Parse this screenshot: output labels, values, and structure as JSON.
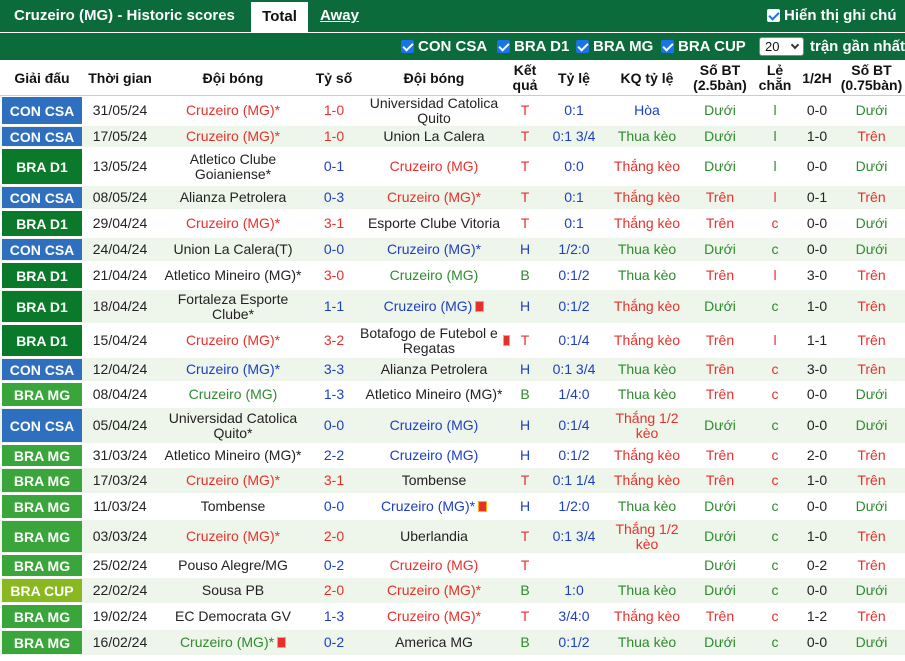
{
  "header": {
    "title": "Cruzeiro (MG) - Historic scores",
    "tab_total": "Total",
    "tab_away": "Away",
    "show_label": "Hiển thị ghi chú"
  },
  "filters": {
    "items": [
      "CON CSA",
      "BRA D1",
      "BRA MG",
      "BRA CUP"
    ],
    "count": "20",
    "recent_label": "trận gần nhất"
  },
  "columns": {
    "league": "Giải đấu",
    "date": "Thời gian",
    "home": "Đội bóng",
    "score": "Tỷ số",
    "away": "Đội bóng",
    "result": "Kết quả",
    "odds": "Tỷ lệ",
    "odds_result": "KQ tỷ lệ",
    "goals": "Số BT (2.5bàn)",
    "oddeven": "Lẻ chẵn",
    "half": "1/2H",
    "goals75": "Số BT (0.75bàn)"
  },
  "colors": {
    "CON CSA": "#2f6fc0",
    "BRA D1": "#0a7a2a",
    "BRA MG": "#3aa53a",
    "BRA CUP": "#8ab820",
    "header_green": "#0b6b3a"
  },
  "rows": [
    {
      "league": "CON CSA",
      "date": "31/05/24",
      "home": "Cruzeiro (MG)*",
      "score": "1-0",
      "away": "Universidad Catolica Quito",
      "result": "T",
      "odds": "0:1",
      "odds_result": "Hòa",
      "goals": "Dưới",
      "oe": "l",
      "half": "0-0",
      "goals75": "Dưới",
      "hc": "red",
      "ac": "dark",
      "ss": "red",
      "rc": "red",
      "okc": "blue",
      "gc": "green",
      "g75c": "green"
    },
    {
      "league": "CON CSA",
      "date": "17/05/24",
      "home": "Cruzeiro (MG)*",
      "score": "1-0",
      "away": "Union La Calera",
      "result": "T",
      "odds": "0:1 3/4",
      "odds_result": "Thua kèo",
      "goals": "Dưới",
      "oe": "l",
      "half": "1-0",
      "goals75": "Trên",
      "hc": "red",
      "ac": "dark",
      "ss": "red",
      "rc": "red",
      "okc": "green",
      "gc": "green",
      "g75c": "red"
    },
    {
      "league": "BRA D1",
      "date": "13/05/24",
      "home": "Atletico Clube Goianiense*",
      "score": "0-1",
      "away": "Cruzeiro (MG)",
      "result": "T",
      "odds": "0:0",
      "odds_result": "Thắng kèo",
      "goals": "Dưới",
      "oe": "l",
      "half": "0-0",
      "goals75": "Dưới",
      "hc": "dark",
      "ac": "red",
      "ss": "blue",
      "rc": "red",
      "okc": "red",
      "gc": "green",
      "g75c": "green"
    },
    {
      "league": "CON CSA",
      "date": "08/05/24",
      "home": "Alianza Petrolera",
      "score": "0-3",
      "away": "Cruzeiro (MG)*",
      "result": "T",
      "odds": "0:1",
      "odds_result": "Thắng kèo",
      "goals": "Trên",
      "oe": "l",
      "half": "0-1",
      "goals75": "Trên",
      "hc": "dark",
      "ac": "red",
      "ss": "blue",
      "rc": "red",
      "okc": "red",
      "gc": "red",
      "g75c": "red"
    },
    {
      "league": "BRA D1",
      "date": "29/04/24",
      "home": "Cruzeiro (MG)*",
      "score": "3-1",
      "away": "Esporte Clube Vitoria",
      "result": "T",
      "odds": "0:1",
      "odds_result": "Thắng kèo",
      "goals": "Trên",
      "oe": "c",
      "half": "0-0",
      "goals75": "Dưới",
      "hc": "red",
      "ac": "dark",
      "ss": "red",
      "rc": "red",
      "okc": "red",
      "gc": "red",
      "g75c": "green"
    },
    {
      "league": "CON CSA",
      "date": "24/04/24",
      "home": "Union La Calera(T)",
      "score": "0-0",
      "away": "Cruzeiro (MG)*",
      "result": "H",
      "odds": "1/2:0",
      "odds_result": "Thua kèo",
      "goals": "Dưới",
      "oe": "c",
      "half": "0-0",
      "goals75": "Dưới",
      "hc": "dark",
      "ac": "blue",
      "ss": "blue",
      "rc": "blue",
      "okc": "green",
      "gc": "green",
      "g75c": "green"
    },
    {
      "league": "BRA D1",
      "date": "21/04/24",
      "home": "Atletico Mineiro (MG)*",
      "score": "3-0",
      "away": "Cruzeiro (MG)",
      "result": "B",
      "odds": "0:1/2",
      "odds_result": "Thua kèo",
      "goals": "Trên",
      "oe": "l",
      "half": "3-0",
      "goals75": "Trên",
      "hc": "dark",
      "ac": "green",
      "ss": "red",
      "rc": "green",
      "okc": "green",
      "gc": "red",
      "g75c": "red"
    },
    {
      "league": "BRA D1",
      "date": "18/04/24",
      "home": "Fortaleza Esporte Clube*",
      "score": "1-1",
      "away": "Cruzeiro (MG)",
      "result": "H",
      "odds": "0:1/2",
      "odds_result": "Thắng kèo",
      "goals": "Dưới",
      "oe": "c",
      "half": "1-0",
      "goals75": "Trên",
      "hc": "dark",
      "ac": "blue",
      "ss": "blue",
      "rc": "blue",
      "okc": "red",
      "gc": "green",
      "g75c": "red",
      "flag": "away"
    },
    {
      "league": "BRA D1",
      "date": "15/04/24",
      "home": "Cruzeiro (MG)*",
      "score": "3-2",
      "away": "Botafogo de Futebol e Regatas",
      "result": "T",
      "odds": "0:1/4",
      "odds_result": "Thắng kèo",
      "goals": "Trên",
      "oe": "l",
      "half": "1-1",
      "goals75": "Trên",
      "hc": "red",
      "ac": "dark",
      "ss": "red",
      "rc": "red",
      "okc": "red",
      "gc": "red",
      "g75c": "red",
      "flag": "away"
    },
    {
      "league": "CON CSA",
      "date": "12/04/24",
      "home": "Cruzeiro (MG)*",
      "score": "3-3",
      "away": "Alianza Petrolera",
      "result": "H",
      "odds": "0:1 3/4",
      "odds_result": "Thua kèo",
      "goals": "Trên",
      "oe": "c",
      "half": "3-0",
      "goals75": "Trên",
      "hc": "blue",
      "ac": "dark",
      "ss": "blue",
      "rc": "blue",
      "okc": "green",
      "gc": "red",
      "g75c": "red"
    },
    {
      "league": "BRA MG",
      "date": "08/04/24",
      "home": "Cruzeiro (MG)",
      "score": "1-3",
      "away": "Atletico Mineiro (MG)*",
      "result": "B",
      "odds": "1/4:0",
      "odds_result": "Thua kèo",
      "goals": "Trên",
      "oe": "c",
      "half": "0-0",
      "goals75": "Dưới",
      "hc": "green",
      "ac": "dark",
      "ss": "blue",
      "rc": "green",
      "okc": "green",
      "gc": "red",
      "g75c": "green"
    },
    {
      "league": "CON CSA",
      "date": "05/04/24",
      "home": "Universidad Catolica Quito*",
      "score": "0-0",
      "away": "Cruzeiro (MG)",
      "result": "H",
      "odds": "0:1/4",
      "odds_result": "Thắng 1/2 kèo",
      "goals": "Dưới",
      "oe": "c",
      "half": "0-0",
      "goals75": "Dưới",
      "hc": "dark",
      "ac": "blue",
      "ss": "blue",
      "rc": "blue",
      "okc": "red",
      "gc": "green",
      "g75c": "green"
    },
    {
      "league": "BRA MG",
      "date": "31/03/24",
      "home": "Atletico Mineiro (MG)*",
      "score": "2-2",
      "away": "Cruzeiro (MG)",
      "result": "H",
      "odds": "0:1/2",
      "odds_result": "Thắng kèo",
      "goals": "Trên",
      "oe": "c",
      "half": "2-0",
      "goals75": "Trên",
      "hc": "dark",
      "ac": "blue",
      "ss": "blue",
      "rc": "blue",
      "okc": "red",
      "gc": "red",
      "g75c": "red"
    },
    {
      "league": "BRA MG",
      "date": "17/03/24",
      "home": "Cruzeiro (MG)*",
      "score": "3-1",
      "away": "Tombense",
      "result": "T",
      "odds": "0:1 1/4",
      "odds_result": "Thắng kèo",
      "goals": "Trên",
      "oe": "c",
      "half": "1-0",
      "goals75": "Trên",
      "hc": "red",
      "ac": "dark",
      "ss": "red",
      "rc": "red",
      "okc": "red",
      "gc": "red",
      "g75c": "red"
    },
    {
      "league": "BRA MG",
      "date": "11/03/24",
      "home": "Tombense",
      "score": "0-0",
      "away": "Cruzeiro (MG)*",
      "result": "H",
      "odds": "1/2:0",
      "odds_result": "Thua kèo",
      "goals": "Dưới",
      "oe": "c",
      "half": "0-0",
      "goals75": "Dưới",
      "hc": "dark",
      "ac": "blue",
      "ss": "blue",
      "rc": "blue",
      "okc": "green",
      "gc": "green",
      "g75c": "green",
      "flag": "away"
    },
    {
      "league": "BRA MG",
      "date": "03/03/24",
      "home": "Cruzeiro (MG)*",
      "score": "2-0",
      "away": "Uberlandia",
      "result": "T",
      "odds": "0:1 3/4",
      "odds_result": "Thắng 1/2 kèo",
      "goals": "Dưới",
      "oe": "c",
      "half": "1-0",
      "goals75": "Trên",
      "hc": "red",
      "ac": "dark",
      "ss": "red",
      "rc": "red",
      "okc": "red",
      "gc": "green",
      "g75c": "red"
    },
    {
      "league": "BRA MG",
      "date": "25/02/24",
      "home": "Pouso Alegre/MG",
      "score": "0-2",
      "away": "Cruzeiro (MG)",
      "result": "T",
      "odds": "",
      "odds_result": "",
      "goals": "Dưới",
      "oe": "c",
      "half": "0-2",
      "goals75": "Trên",
      "hc": "dark",
      "ac": "red",
      "ss": "blue",
      "rc": "red",
      "okc": "red",
      "gc": "green",
      "g75c": "red"
    },
    {
      "league": "BRA CUP",
      "date": "22/02/24",
      "home": "Sousa PB",
      "score": "2-0",
      "away": "Cruzeiro (MG)*",
      "result": "B",
      "odds": "1:0",
      "odds_result": "Thua kèo",
      "goals": "Dưới",
      "oe": "c",
      "half": "0-0",
      "goals75": "Dưới",
      "hc": "dark",
      "ac": "red",
      "ss": "red",
      "rc": "green",
      "okc": "green",
      "gc": "green",
      "g75c": "green"
    },
    {
      "league": "BRA MG",
      "date": "19/02/24",
      "home": "EC Democrata GV",
      "score": "1-3",
      "away": "Cruzeiro (MG)*",
      "result": "T",
      "odds": "3/4:0",
      "odds_result": "Thắng kèo",
      "goals": "Trên",
      "oe": "c",
      "half": "1-2",
      "goals75": "Trên",
      "hc": "dark",
      "ac": "red",
      "ss": "blue",
      "rc": "red",
      "okc": "red",
      "gc": "red",
      "g75c": "red"
    },
    {
      "league": "BRA MG",
      "date": "16/02/24",
      "home": "Cruzeiro (MG)*",
      "score": "0-2",
      "away": "America MG",
      "result": "B",
      "odds": "0:1/2",
      "odds_result": "Thua kèo",
      "goals": "Dưới",
      "oe": "c",
      "half": "0-0",
      "goals75": "Dưới",
      "hc": "green",
      "ac": "dark",
      "ss": "blue",
      "rc": "green",
      "okc": "green",
      "gc": "green",
      "g75c": "green",
      "flag": "home"
    }
  ]
}
